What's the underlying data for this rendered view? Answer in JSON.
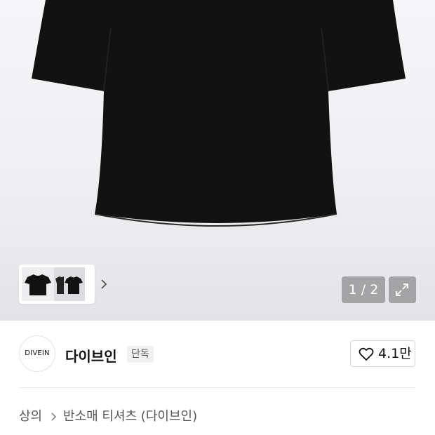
{
  "gallery": {
    "pager_text": "1 / 2",
    "expand_icon": "expand-icon",
    "thumbnail_next_icon": "chevron-right-icon"
  },
  "brand": {
    "logo_text": "DIVEIN",
    "name": "다이브인",
    "badge": "단독"
  },
  "like": {
    "icon": "heart-icon",
    "count": "4.1만"
  },
  "breadcrumb": {
    "items": [
      "상의",
      "반소매 티셔츠 (다이브인)"
    ],
    "separator_icon": "chevron-right-icon"
  },
  "colors": {
    "shirt": "#111111",
    "pager_bg": "#6e6e6e",
    "text": "#111111"
  }
}
